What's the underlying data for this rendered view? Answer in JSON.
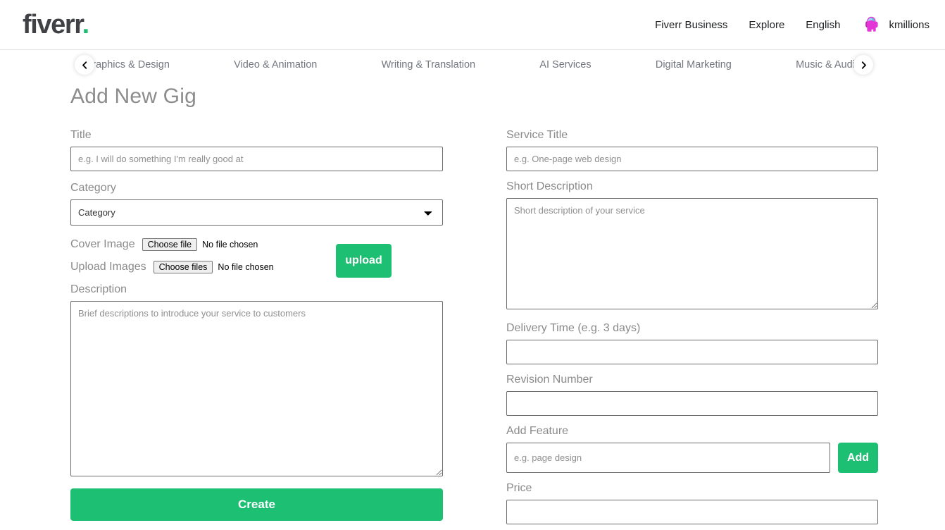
{
  "header": {
    "logo_text": "fiverr",
    "logo_dot": ".",
    "links": [
      {
        "label": "Fiverr Business",
        "name": "fiverr-business"
      },
      {
        "label": "Explore",
        "name": "explore"
      },
      {
        "label": "English",
        "name": "english"
      }
    ],
    "avatar_icon": "among-us-avatar-icon",
    "username": "kmillions",
    "accent_color": "#1dbf73",
    "avatar_color": "#e436d6"
  },
  "category_nav": {
    "prev_icon": "chevron-left-icon",
    "next_icon": "chevron-right-icon",
    "items": [
      "Graphics & Design",
      "Video & Animation",
      "Writing & Translation",
      "AI Services",
      "Digital Marketing",
      "Music & Audio"
    ]
  },
  "page": {
    "title": "Add New Gig"
  },
  "left_form": {
    "title_label": "Title",
    "title_placeholder": "e.g. I will do something I'm really good at",
    "title_value": "",
    "category_label": "Category",
    "category_selected": "Category",
    "category_options": [
      "Category"
    ],
    "cover_image_label": "Cover Image",
    "cover_image_button": "Choose file",
    "cover_image_status": "No file chosen",
    "upload_images_label": "Upload Images",
    "upload_images_button": "Choose files",
    "upload_images_status": "No file chosen",
    "upload_button": "upload",
    "description_label": "Description",
    "description_placeholder": "Brief descriptions to introduce your service to customers",
    "description_value": "",
    "create_button": "Create"
  },
  "right_form": {
    "service_title_label": "Service Title",
    "service_title_placeholder": "e.g. One-page web design",
    "service_title_value": "",
    "short_description_label": "Short Description",
    "short_description_placeholder": "Short description of your service",
    "short_description_value": "",
    "delivery_time_label": "Delivery Time (e.g. 3 days)",
    "delivery_time_placeholder": "",
    "delivery_time_value": "",
    "revision_number_label": "Revision Number",
    "revision_number_placeholder": "",
    "revision_number_value": "",
    "add_feature_label": "Add Feature",
    "add_feature_placeholder": "e.g. page design",
    "add_feature_value": "",
    "add_button": "Add",
    "price_label": "Price",
    "price_placeholder": "",
    "price_value": ""
  }
}
